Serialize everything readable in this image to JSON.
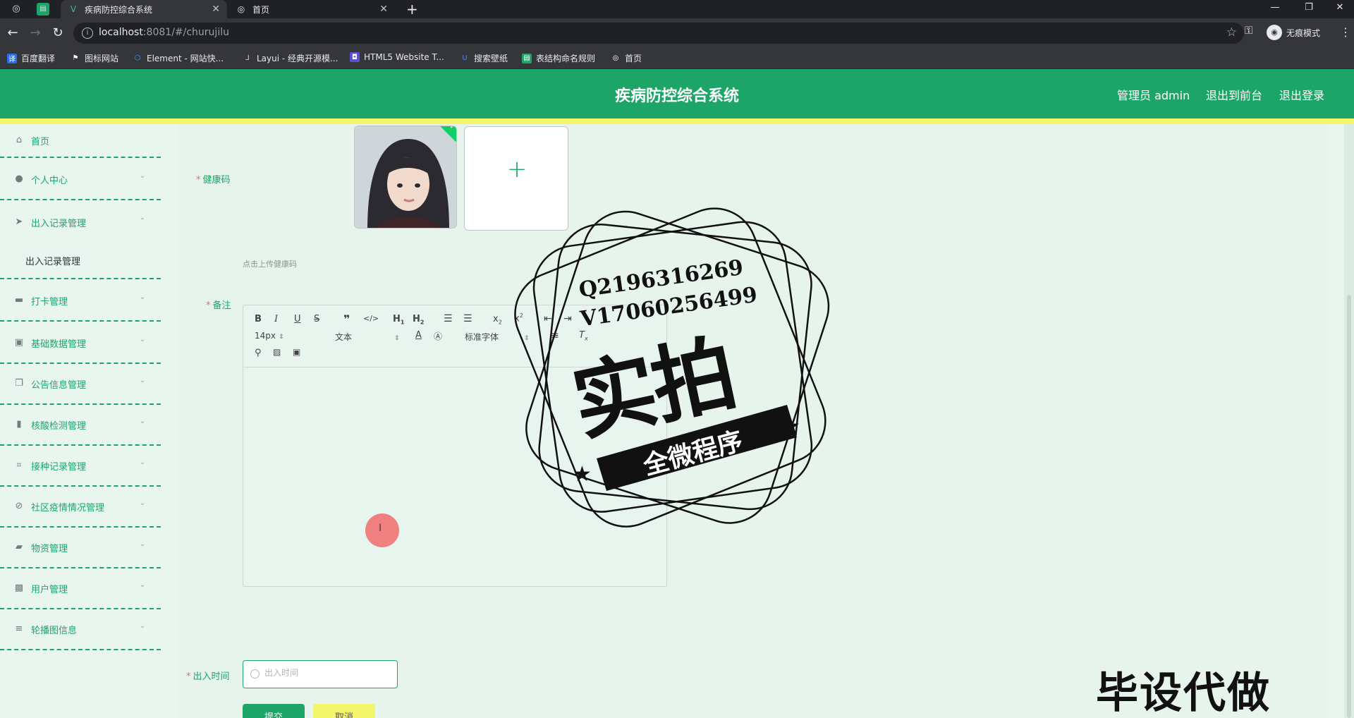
{
  "browser": {
    "tabs": [
      {
        "label": "疾病防控综合系统",
        "active": true
      },
      {
        "label": "首页",
        "active": false
      }
    ],
    "url_host": "localhost",
    "url_path": ":8081/#/churujilu",
    "profile_label": "无痕模式",
    "bookmarks": [
      "百度翻译",
      "图标网站",
      "Element - 网站快...",
      "Layui - 经典开源模...",
      "HTML5 Website T...",
      "搜索壁纸",
      "表结构命名规则",
      "首页"
    ]
  },
  "header": {
    "title": "疾病防控综合系统",
    "user_label": "管理员 admin",
    "front_link": "退出到前台",
    "logout_link": "退出登录"
  },
  "sidebar": {
    "items": [
      {
        "label": "首页",
        "icon": "home-icon"
      },
      {
        "label": "个人中心",
        "icon": "user-icon"
      },
      {
        "label": "出入记录管理",
        "icon": "send-icon"
      },
      {
        "label": "出入记录管理",
        "icon": ""
      },
      {
        "label": "打卡管理",
        "icon": "briefcase-icon"
      },
      {
        "label": "基础数据管理",
        "icon": "clipboard-icon"
      },
      {
        "label": "公告信息管理",
        "icon": "copy-icon"
      },
      {
        "label": "核酸检测管理",
        "icon": "bar-chart-icon"
      },
      {
        "label": "接种记录管理",
        "icon": "crop-icon"
      },
      {
        "label": "社区疫情情况管理",
        "icon": "bell-off-icon"
      },
      {
        "label": "物资管理",
        "icon": "box-icon"
      },
      {
        "label": "用户管理",
        "icon": "user-badge-icon"
      },
      {
        "label": "轮播图信息",
        "icon": "sliders-icon"
      }
    ]
  },
  "form": {
    "health_code_label": "健康码",
    "upload_hint": "点击上传健康码",
    "remark_label": "备注",
    "editor_font_size": "14px",
    "editor_block_type": "文本",
    "editor_font_family": "标准字体",
    "time_label": "出入时间",
    "time_placeholder": "出入时间",
    "submit_label": "提交",
    "cancel_label": "取消"
  },
  "watermark": {
    "line1": "Q2196316269",
    "line2": "V17060256499",
    "big": "实拍",
    "ribbon": "全微程序",
    "corner": "毕设代做"
  },
  "colors": {
    "brand": "#1da568",
    "accent_yellow": "#f3f56a",
    "required": "#f56c6c"
  }
}
